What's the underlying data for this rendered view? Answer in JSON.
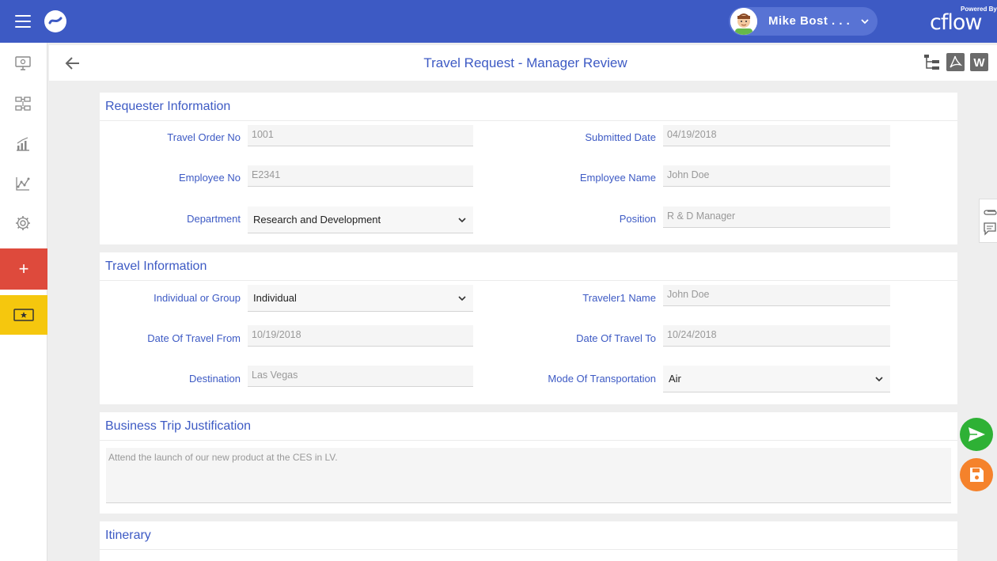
{
  "header": {
    "user_name": "Mike Bost . . .",
    "powered_by": "Powered By",
    "brand": "cflow",
    "page_title": "Travel Request - Manager Review"
  },
  "sidebar": {
    "add_label": "+"
  },
  "requester": {
    "title": "Requester Information",
    "travel_order_label": "Travel Order No",
    "travel_order_value": "1001",
    "submitted_date_label": "Submitted Date",
    "submitted_date_value": "04/19/2018",
    "employee_no_label": "Employee No",
    "employee_no_value": "E2341",
    "employee_name_label": "Employee Name",
    "employee_name_value": "John Doe",
    "department_label": "Department",
    "department_value": "Research and Development",
    "position_label": "Position",
    "position_value": "R & D Manager"
  },
  "travel": {
    "title": "Travel Information",
    "individual_group_label": "Individual or Group",
    "individual_group_value": "Individual",
    "traveler1_label": "Traveler1 Name",
    "traveler1_value": "John Doe",
    "date_from_label": "Date Of Travel From",
    "date_from_value": "10/19/2018",
    "date_to_label": "Date Of Travel To",
    "date_to_value": "10/24/2018",
    "destination_label": "Destination",
    "destination_value": "Las Vegas",
    "mode_label": "Mode Of Transportation",
    "mode_value": "Air"
  },
  "justification": {
    "title": "Business Trip Justification",
    "text": "Attend the launch of our new product at the CES in LV."
  },
  "itinerary": {
    "title": "Itinerary"
  },
  "colors": {
    "primary": "#3d5ac4",
    "add_button": "#de4a3c",
    "ticket_button": "#f5c70e",
    "submit_fab": "#2eb135",
    "save_fab": "#f5822b"
  },
  "icons": {
    "menu": "hamburger-icon",
    "back": "back-arrow-icon",
    "tree": "tree-view-icon",
    "pdf": "pdf-icon",
    "word": "word-icon",
    "send": "send-icon",
    "save": "save-icon"
  }
}
